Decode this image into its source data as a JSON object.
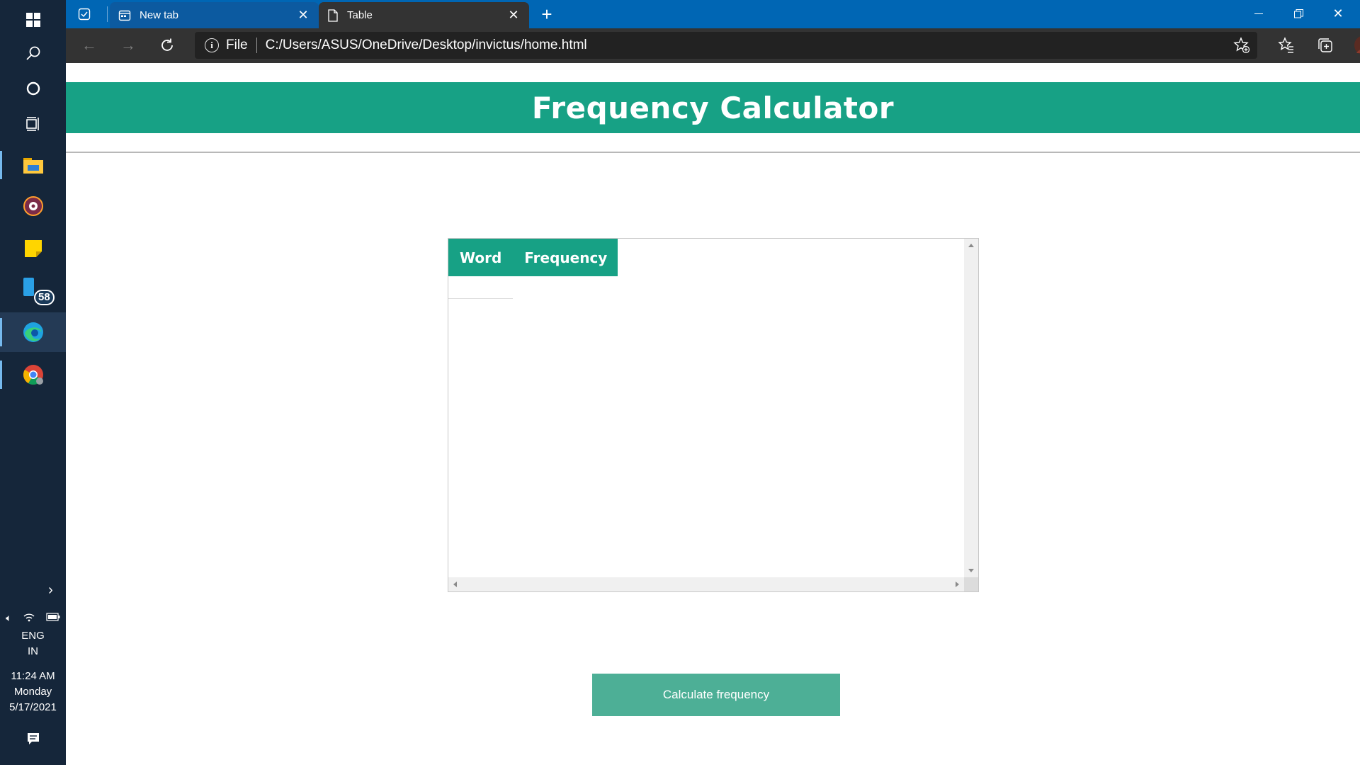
{
  "taskbar": {
    "tray": {
      "lang_line1": "ENG",
      "lang_line2": "IN",
      "time": "11:24 AM",
      "day": "Monday",
      "date": "5/17/2021"
    },
    "badge_count": "58",
    "icons": [
      "windows-start-icon",
      "search-icon",
      "cortana-icon",
      "task-view-icon",
      "file-explorer-icon",
      "media-app-icon",
      "sticky-notes-icon",
      "phone-app-icon",
      "edge-icon",
      "chrome-icon"
    ]
  },
  "browser": {
    "tabs": [
      {
        "title": "New tab",
        "active": false
      },
      {
        "title": "Table",
        "active": true
      }
    ],
    "address": {
      "scheme_label": "File",
      "url": "C:/Users/ASUS/OneDrive/Desktop/invictus/home.html"
    },
    "colors": {
      "titlebar": "#0066b4",
      "toolbar": "#333333"
    }
  },
  "page": {
    "title": "Frequency Calculator",
    "table": {
      "columns": [
        "Word",
        "Frequency"
      ],
      "rows": []
    },
    "button_label": "Calculate frequency",
    "colors": {
      "accent": "#17a185",
      "button": "#4daf96"
    }
  }
}
